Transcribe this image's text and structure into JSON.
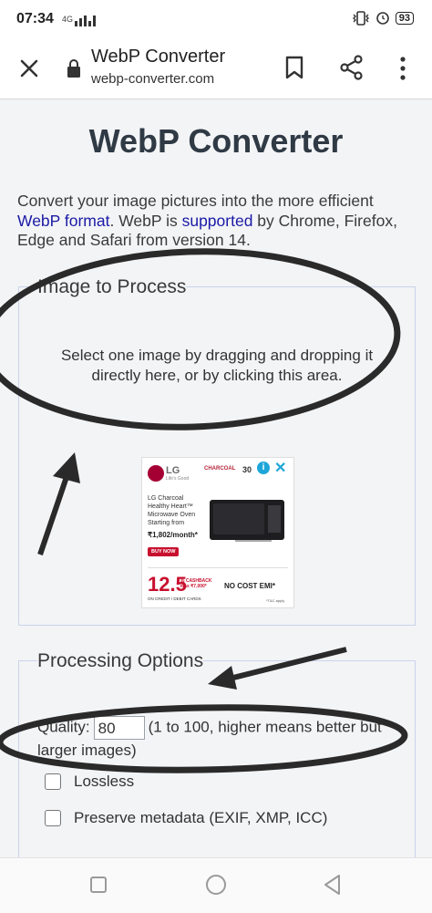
{
  "statusbar": {
    "time": "07:34",
    "network": "4G",
    "battery": "93"
  },
  "toolbar": {
    "title": "WebP Converter",
    "url": "webp-converter.com"
  },
  "page": {
    "title": "WebP Converter",
    "intro": {
      "part1": "Convert your image pictures into the more efficient ",
      "link1": "WebP format",
      "part2": ". WebP is ",
      "link2": "supported",
      "part3": " by Chrome, Firefox, Edge and Safari from version 14."
    }
  },
  "upload": {
    "legend": "Image to Process",
    "drop_text": "Select one image by dragging and dropping it directly here, or by clicking this area."
  },
  "ad": {
    "brand": "LG",
    "brand_tagline": "Life's Good",
    "charcoal": "CHARCOAL",
    "years": "30",
    "info": "i",
    "close": "✕",
    "line1": "LG Charcoal",
    "line2": "Healthy Heart™",
    "line3": "Microwave Oven",
    "starting": "Starting from",
    "price": "₹1,802/month*",
    "buy": "BUY NOW",
    "cashback_value": "12.5",
    "cashback_label": "% CASHBACK Max ₹7,000*",
    "card": "ON CREDIT / DEBIT CARDS",
    "emi": "NO COST EMI*",
    "tc": "*T&C apply"
  },
  "options": {
    "legend": "Processing Options",
    "quality_label": "Quality:",
    "quality_value": "80",
    "quality_hint": "(1 to 100, higher means better but larger images)",
    "lossless_label": "Lossless",
    "metadata_label": "Preserve metadata (EXIF, XMP, ICC)"
  }
}
